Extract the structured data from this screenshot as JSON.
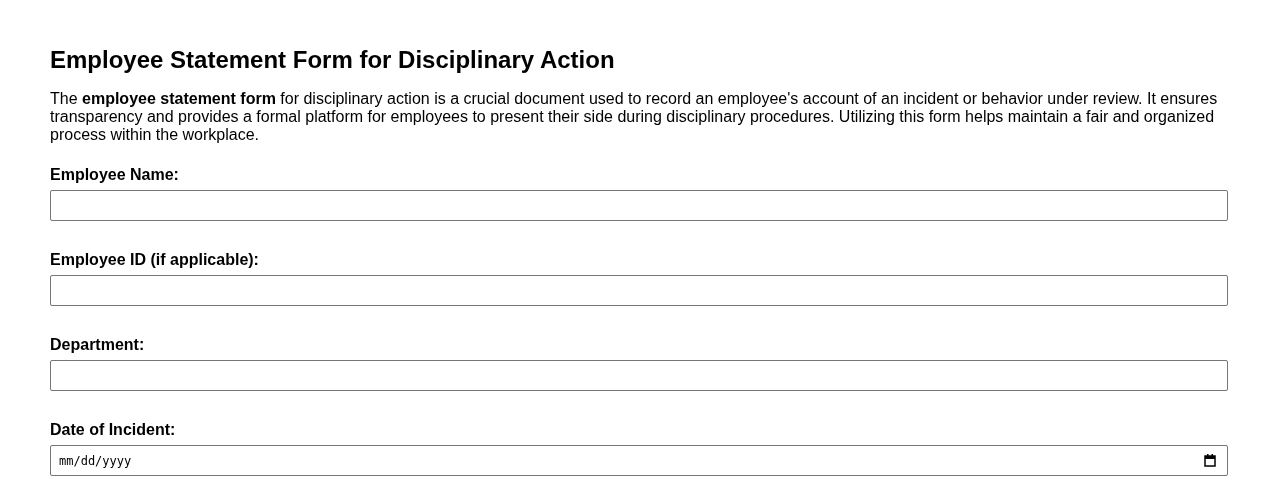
{
  "title": "Employee Statement Form for Disciplinary Action",
  "intro": "The **employee statement form** for disciplinary action is a crucial document used to record an employee's account of an incident or behavior under review. It ensures transparency and provides a formal platform for employees to present their side during disciplinary procedures. Utilizing this form helps maintain a fair and organized process within the workplace.",
  "fields": [
    {
      "label": "Employee Name:",
      "kind": "text"
    },
    {
      "label": "Employee ID (if applicable):",
      "kind": "text"
    },
    {
      "label": "Department:",
      "kind": "text"
    },
    {
      "label": "Date of Incident:",
      "kind": "date",
      "placeholder": "mm/dd/yyyy"
    }
  ]
}
